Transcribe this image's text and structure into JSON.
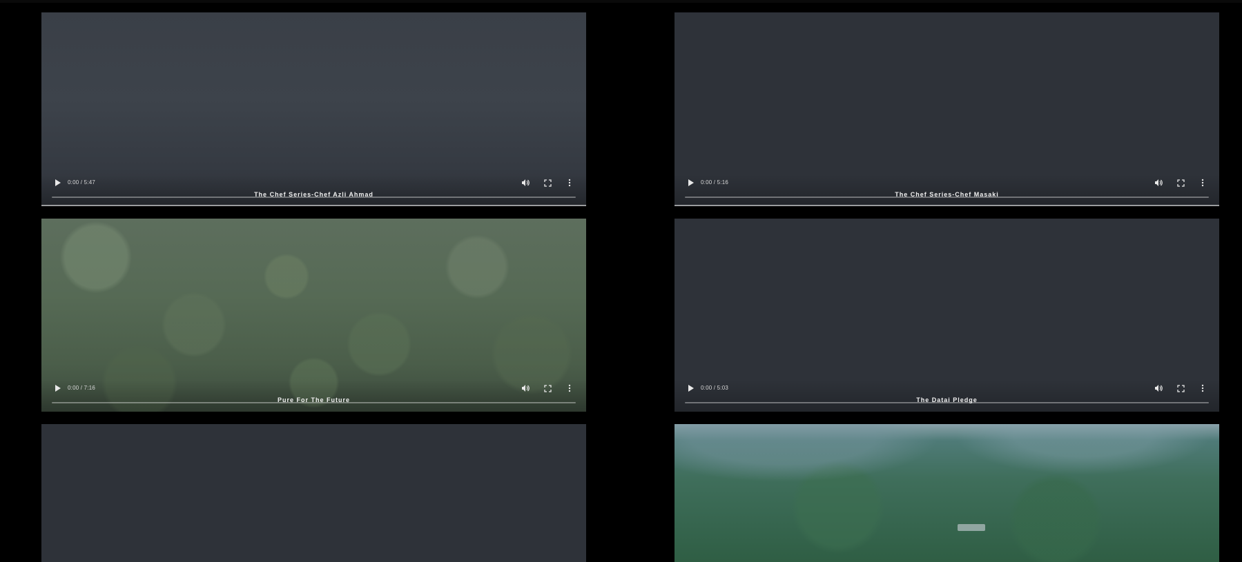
{
  "videos": [
    {
      "title": "The Chef Series-Chef Azli Ahmad",
      "time": "0:00 / 5:47",
      "thumbnail": "foggy-dark",
      "progress": 0
    },
    {
      "title": "The Chef Series-Chef Masaki",
      "time": "0:00 / 5:16",
      "thumbnail": "dark-plain",
      "progress": 0
    },
    {
      "title": "Pure For The Future",
      "time": "0:00 / 7:16",
      "thumbnail": "rainforest-canopy",
      "progress": 0
    },
    {
      "title": "The Datai Pledge",
      "time": "0:00 / 5:03",
      "thumbnail": "dark-plain",
      "progress": 0
    }
  ],
  "icons": {
    "play": "play-icon",
    "volume": "volume-icon",
    "fullscreen": "fullscreen-icon",
    "more": "more-options-icon"
  },
  "colors": {
    "page_bg": "#000000",
    "player_bg": "#2d3139",
    "control_text": "#e8e8e8"
  }
}
